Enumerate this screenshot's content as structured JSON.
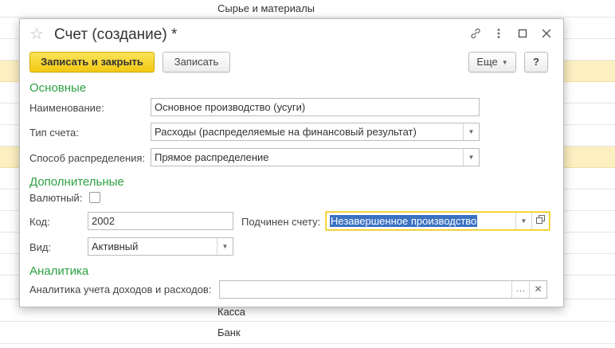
{
  "background": {
    "rows": [
      {
        "text": "Сырье и материалы",
        "highlight": false
      },
      {
        "text": "",
        "highlight": false
      },
      {
        "text": "",
        "highlight": false
      },
      {
        "text": "",
        "highlight": true
      },
      {
        "text": "",
        "highlight": false
      },
      {
        "text": "",
        "highlight": false
      },
      {
        "text": "",
        "highlight": false
      },
      {
        "text": "",
        "highlight": true
      },
      {
        "text": "",
        "highlight": false
      },
      {
        "text": "",
        "highlight": false
      },
      {
        "text": "",
        "highlight": false
      },
      {
        "text": "",
        "highlight": false
      },
      {
        "text": "",
        "highlight": false
      },
      {
        "text": "",
        "highlight": false
      },
      {
        "text": "Касса",
        "highlight": false
      },
      {
        "text": "Банк",
        "highlight": false
      }
    ]
  },
  "dialog": {
    "title": "Счет (создание) *",
    "toolbar": {
      "save_close_label": "Записать и закрыть",
      "save_label": "Записать",
      "more_label": "Еще",
      "help_label": "?"
    },
    "sections": {
      "main": "Основные",
      "additional": "Дополнительные",
      "analytics": "Аналитика"
    },
    "fields": {
      "name": {
        "label": "Наименование:",
        "value": "Основное производство (усуги)"
      },
      "account_type": {
        "label": "Тип счета:",
        "value": "Расходы (распределяемые на финансовый результат)"
      },
      "distribution": {
        "label": "Способ распределения:",
        "value": "Прямое распределение"
      },
      "currency": {
        "label": "Валютный:",
        "checked": false
      },
      "code": {
        "label": "Код:",
        "value": "2002"
      },
      "parent": {
        "label": "Подчинен счету:",
        "value": "Незавершенное производство"
      },
      "kind": {
        "label": "Вид:",
        "value": "Активный"
      },
      "analytics": {
        "label": "Аналитика учета доходов и расходов:",
        "value": ""
      }
    },
    "accent_colors": {
      "primary_button": "#f2c811",
      "section_title": "#2ea043",
      "selection": "#3b72c3"
    }
  }
}
